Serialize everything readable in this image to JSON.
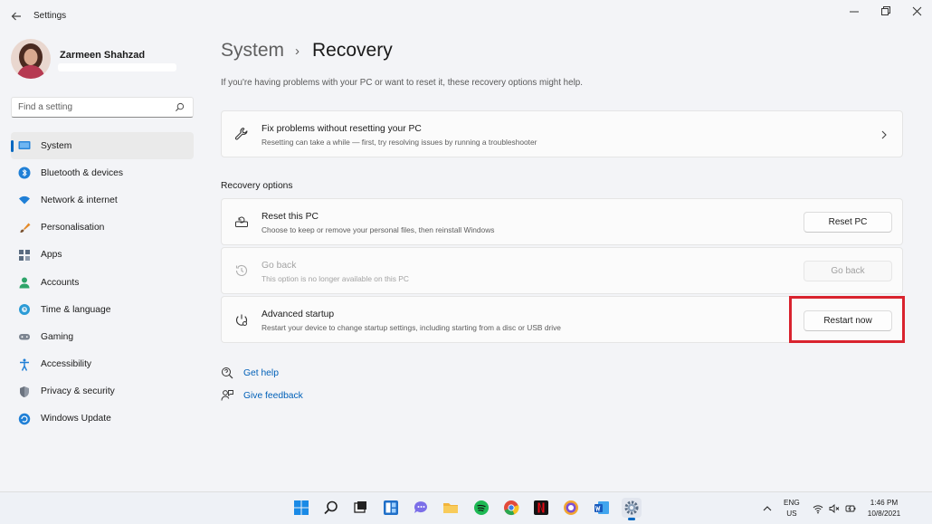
{
  "window": {
    "title": "Settings"
  },
  "profile": {
    "name": "Zarmeen Shahzad"
  },
  "search": {
    "placeholder": "Find a setting"
  },
  "nav": {
    "items": [
      {
        "label": "System",
        "icon": "monitor-icon",
        "active": true
      },
      {
        "label": "Bluetooth & devices",
        "icon": "bluetooth-icon"
      },
      {
        "label": "Network & internet",
        "icon": "wifi-icon"
      },
      {
        "label": "Personalisation",
        "icon": "brush-icon"
      },
      {
        "label": "Apps",
        "icon": "apps-icon"
      },
      {
        "label": "Accounts",
        "icon": "person-icon"
      },
      {
        "label": "Time & language",
        "icon": "globe-clock-icon"
      },
      {
        "label": "Gaming",
        "icon": "gamepad-icon"
      },
      {
        "label": "Accessibility",
        "icon": "accessibility-icon"
      },
      {
        "label": "Privacy & security",
        "icon": "shield-icon"
      },
      {
        "label": "Windows Update",
        "icon": "update-icon"
      }
    ]
  },
  "page": {
    "breadcrumb_parent": "System",
    "breadcrumb_separator": "›",
    "title": "Recovery",
    "subtitle": "If you're having problems with your PC or want to reset it, these recovery options might help."
  },
  "fix_card": {
    "title": "Fix problems without resetting your PC",
    "description": "Resetting can take a while — first, try resolving issues by running a troubleshooter"
  },
  "recovery_options": {
    "heading": "Recovery options",
    "reset": {
      "title": "Reset this PC",
      "description": "Choose to keep or remove your personal files, then reinstall Windows",
      "button": "Reset PC"
    },
    "go_back": {
      "title": "Go back",
      "description": "This option is no longer available on this PC",
      "button": "Go back"
    },
    "advanced": {
      "title": "Advanced startup",
      "description": "Restart your device to change startup settings, including starting from a disc or USB drive",
      "button": "Restart now"
    }
  },
  "help": {
    "get_help": "Get help",
    "give_feedback": "Give feedback"
  },
  "taskbar": {
    "apps": [
      "start",
      "search",
      "task-view",
      "widgets",
      "chat",
      "file-explorer",
      "spotify",
      "chrome",
      "netflix",
      "browser",
      "word",
      "settings"
    ]
  },
  "tray": {
    "lang_line1": "ENG",
    "lang_line2": "US",
    "time": "1:46 PM",
    "date": "10/8/2021"
  },
  "colors": {
    "accent": "#0067c0",
    "highlight": "#d9232e",
    "link": "#0060b8"
  }
}
